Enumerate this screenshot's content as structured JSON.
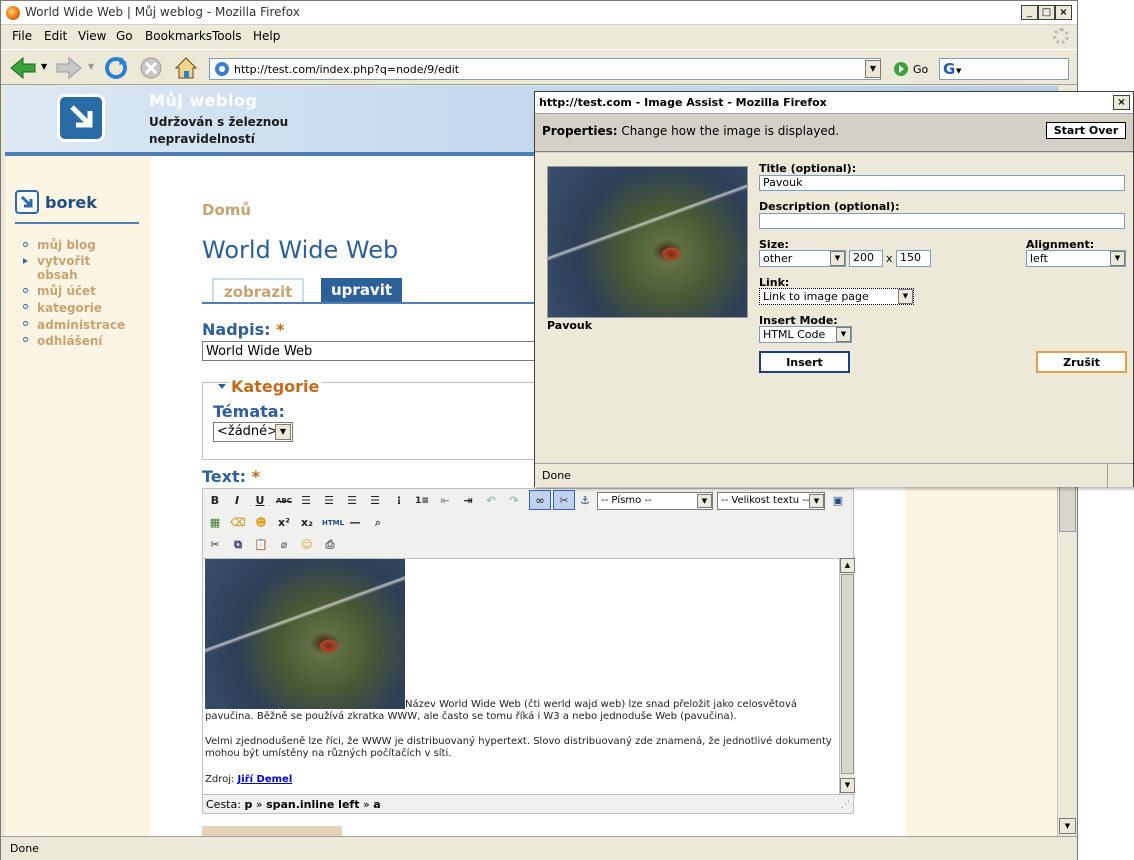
{
  "browser": {
    "title": "World Wide Web | Můj weblog - Mozilla Firefox",
    "menu": [
      "File",
      "Edit",
      "View",
      "Go",
      "Bookmarks",
      "Tools",
      "Help"
    ],
    "url": "http://test.com/index.php?q=node/9/edit",
    "go_label": "Go",
    "status": "Done"
  },
  "site": {
    "name": "Můj weblog",
    "slogan": "Udržován s železnou nepravidelností"
  },
  "sidebar": {
    "user": "borek",
    "items": [
      {
        "label": "můj blog"
      },
      {
        "label": "vytvořit obsah"
      },
      {
        "label": "můj účet"
      },
      {
        "label": "kategorie"
      },
      {
        "label": "administrace"
      },
      {
        "label": "odhlášení"
      }
    ]
  },
  "main": {
    "breadcrumb": "Domů",
    "title": "World Wide Web",
    "tabs": [
      {
        "label": "zobrazit"
      },
      {
        "label": "upravit"
      }
    ],
    "nadpis_label": "Nadpis:",
    "required_mark": "*",
    "nadpis_value": "World Wide Web",
    "kategorie_legend": "Kategorie",
    "temata_label": "Témata:",
    "temata_value": "<žádné>",
    "text_label": "Text:"
  },
  "editor": {
    "font_select": "-- Písmo --",
    "size_select": "-- Velikost textu --",
    "paragraph1_lead": "Název World Wide Web (čti werld wajd web) lze snad přeložit jako celosvětová",
    "paragraph1_rest": "pavučina. Běžně se používá zkratka WWW, ale často se tomu říká i W3 a nebo jednoduše Web (pavučina).",
    "paragraph2": "Velmi zjednodušeně lze říci, že WWW je distribuovaný hypertext. Slovo distribuovaný zde znamená, že jednotlivé dokumenty mohou být umístěny na různých počítačích v síti.",
    "source_label": "Zdroj:",
    "source_link": "Jiří Demel",
    "path_label": "Cesta:",
    "path": [
      {
        "text": "p"
      },
      {
        "text": "span.inline left"
      },
      {
        "text": "a"
      }
    ],
    "path_sep": "»"
  },
  "popup": {
    "title": "http://test.com - Image Assist - Mozilla Firefox",
    "properties_label": "Properties:",
    "properties_text": "Change how the image is displayed.",
    "start_over": "Start Over",
    "image_caption": "Pavouk",
    "title_label": "Title (optional):",
    "title_value": "Pavouk",
    "description_label": "Description (optional):",
    "description_value": "",
    "size_label": "Size:",
    "size_select": "other",
    "width_value": "200",
    "times": "x",
    "height_value": "150",
    "alignment_label": "Alignment:",
    "alignment_value": "left",
    "link_label": "Link:",
    "link_value": "Link to image page",
    "insert_mode_label": "Insert Mode:",
    "insert_mode_value": "HTML Code",
    "insert_button": "Insert",
    "cancel_button": "Zrušit",
    "status": "Done"
  }
}
